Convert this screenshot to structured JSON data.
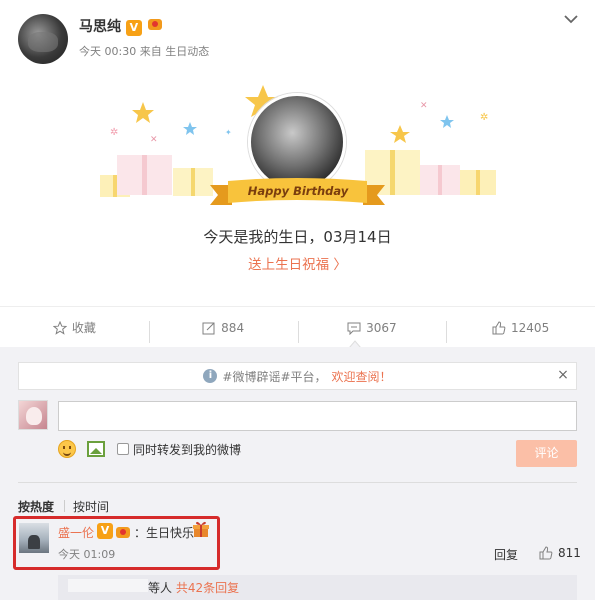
{
  "post": {
    "username": "马思纯",
    "v_badge": "V",
    "meta": "今天 00:30 来自 生日动态"
  },
  "birthday": {
    "ribbon_text": "Happy Birthday",
    "message": "今天是我的生日，03月14日",
    "wish_link": "送上生日祝福 〉"
  },
  "actions": {
    "favorite_label": "收藏",
    "repost_count": "884",
    "comment_count": "3067",
    "like_count": "12405"
  },
  "notice": {
    "prefix": "#微博辟谣#平台，",
    "link": "欢迎查阅！",
    "close": "×"
  },
  "composer": {
    "repost_label": "同时转发到我的微博",
    "submit_label": "评论"
  },
  "sort": {
    "hot": "按热度",
    "time": "按时间"
  },
  "comment": {
    "username": "盛一伦",
    "v_badge": "V",
    "text": "：生日快乐",
    "time": "今天 01:09",
    "reply_label": "回复",
    "like_count": "811",
    "sub_reply_text": "等人",
    "sub_reply_link": "共42条回复"
  },
  "colors": {
    "accent": "#eb7350",
    "badge": "#f7a116",
    "highlight": "#d62b2b"
  }
}
